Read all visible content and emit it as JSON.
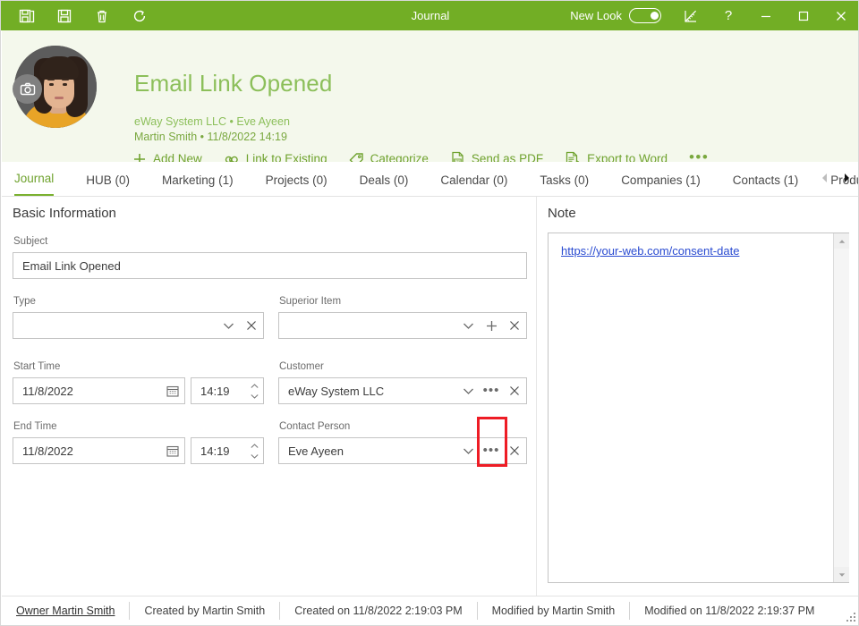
{
  "titlebar": {
    "title": "Journal",
    "tools": [
      {
        "name": "save-and-close-icon",
        "label": "Save and Close"
      },
      {
        "name": "save-icon",
        "label": "Save"
      },
      {
        "name": "delete-icon",
        "label": "Delete"
      },
      {
        "name": "refresh-icon",
        "label": "Refresh"
      }
    ],
    "new_look_label": "New Look",
    "new_look_on": true,
    "design_icon": "ruler-pencil-icon",
    "help_label": "?",
    "minimize_label": "—",
    "maximize_label": "□",
    "close_label": "✕",
    "accent_color": "#72ae25"
  },
  "header": {
    "title": "Email Link Opened",
    "subtitle_company_contact": "eWay System LLC • Eve Ayeen",
    "subtitle_owner_date": "Martin Smith • 11/8/2022 14:19",
    "avatar_camera_icon": "camera-icon",
    "background_color": "#f4f8ec",
    "title_color": "#8cbf5a",
    "actions": [
      {
        "icon": "plus-icon",
        "label": "Add New"
      },
      {
        "icon": "link-icon",
        "label": "Link to Existing"
      },
      {
        "icon": "tag-icon",
        "label": "Categorize"
      },
      {
        "icon": "pdf-icon",
        "label": "Send as PDF"
      },
      {
        "icon": "word-icon",
        "label": "Export to Word"
      }
    ],
    "more_actions_label": "•••"
  },
  "tabs": {
    "items": [
      {
        "label": "Journal",
        "active": true
      },
      {
        "label": "HUB (0)",
        "active": false
      },
      {
        "label": "Marketing (1)",
        "active": false
      },
      {
        "label": "Projects (0)",
        "active": false
      },
      {
        "label": "Deals (0)",
        "active": false
      },
      {
        "label": "Calendar (0)",
        "active": false
      },
      {
        "label": "Tasks (0)",
        "active": false
      },
      {
        "label": "Companies (1)",
        "active": false
      },
      {
        "label": "Contacts (1)",
        "active": false
      },
      {
        "label": "Products (",
        "active": false
      }
    ],
    "scroll_left_icon": "chevron-left-icon",
    "scroll_right_icon": "chevron-right-icon",
    "scroll_left_enabled": false,
    "scroll_right_enabled": true
  },
  "form": {
    "section_title": "Basic Information",
    "subject": {
      "label": "Subject",
      "value": "Email Link Opened"
    },
    "type": {
      "label": "Type",
      "value": "",
      "placeholder": ""
    },
    "superior_item": {
      "label": "Superior Item",
      "value": "",
      "placeholder": ""
    },
    "start_time": {
      "label": "Start Time",
      "date": "11/8/2022",
      "time": "14:19"
    },
    "end_time": {
      "label": "End Time",
      "date": "11/8/2022",
      "time": "14:19"
    },
    "customer": {
      "label": "Customer",
      "value": "eWay System LLC"
    },
    "contact_person": {
      "label": "Contact Person",
      "value": "Eve Ayeen"
    },
    "icons": {
      "dropdown": "chevron-down-icon",
      "clear": "close-x-icon",
      "add": "plus-icon",
      "browse": "ellipsis-icon",
      "calendar": "calendar-icon",
      "spinner": "spinner-arrows-icon"
    }
  },
  "note": {
    "title": "Note",
    "link_text": "https://your-web.com/consent-date",
    "scroll_up_icon": "scroll-up-icon",
    "scroll_down_icon": "scroll-down-icon"
  },
  "highlight": {
    "color": "#ee1c25",
    "target": "contact-person-browse-button"
  },
  "statusbar": {
    "items": [
      {
        "label": "Owner Martin Smith",
        "link": true
      },
      {
        "label": "Created by Martin Smith",
        "link": false
      },
      {
        "label": "Created on 11/8/2022 2:19:03 PM",
        "link": false
      },
      {
        "label": "Modified by Martin Smith",
        "link": false
      },
      {
        "label": "Modified on 11/8/2022 2:19:37 PM",
        "link": false
      }
    ],
    "resize_grip_icon": "resize-grip-icon"
  }
}
